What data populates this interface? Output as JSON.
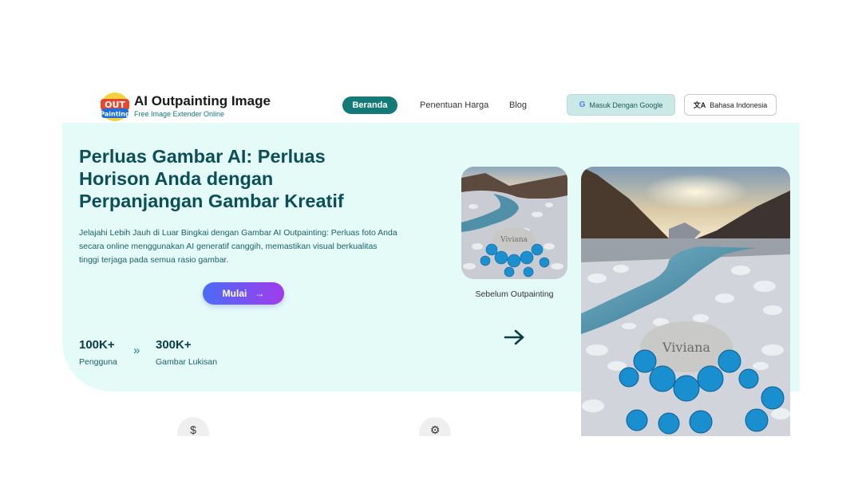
{
  "header": {
    "brand_title": "AI Outpainting Image",
    "brand_subtitle": "Free Image Extender Online",
    "logo_text_top": "OUT",
    "logo_text_bottom": "Painting",
    "nav": {
      "home": "Beranda",
      "pricing": "Penentuan Harga",
      "blog": "Blog"
    },
    "login_google": "Masuk Dengan Google",
    "google_icon_glyph": "G",
    "language": "Bahasa Indonesia",
    "language_icon_glyph": "文A"
  },
  "hero": {
    "title": "Perluas Gambar AI: Perluas Horison Anda dengan Perpanjangan Gambar Kreatif",
    "description": "Jelajahi Lebih Jauh di Luar Bingkai dengan Gambar AI Outpainting: Perluas foto Anda secara online menggunakan AI generatif canggih, memastikan visual berkualitas tinggi terjaga pada semua rasio gambar.",
    "start_button": "Mulai",
    "start_arrow": "→",
    "stats": [
      {
        "value": "100K+",
        "label": "Pengguna"
      },
      {
        "value": "300K+",
        "label": "Gambar Lukisan"
      }
    ],
    "stats_separator": "»",
    "before_caption": "Sebelum Outpainting",
    "stone_text": "Viviana"
  },
  "features": {
    "icons": [
      "dollar-icon",
      "brain-icon"
    ],
    "dollar_glyph": "$",
    "brain_glyph": "⚙"
  },
  "colors": {
    "primary": "#137a78",
    "hero_bg": "#e5fbf8",
    "heading": "#0b4f58",
    "google_btn_bg": "#c9e8e6",
    "start_gradient_from": "#4b6cf7",
    "start_gradient_to": "#a03cea"
  }
}
